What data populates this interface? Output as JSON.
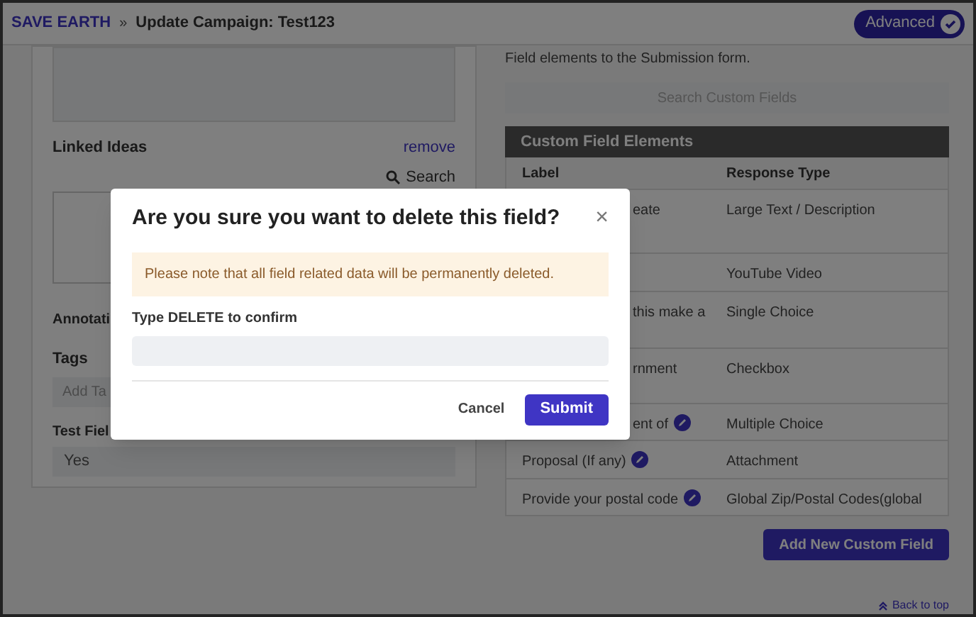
{
  "header": {
    "brand": "SAVE EARTH",
    "separator": "»",
    "title": "Update Campaign: Test123",
    "advanced": {
      "label": "Advanced",
      "on": true
    }
  },
  "left": {
    "linked_ideas": {
      "label": "Linked Ideas",
      "remove": "remove",
      "search": "Search"
    },
    "annotations_label": "Annotati",
    "tags_label": "Tags",
    "tags_placeholder": "Add Ta",
    "test_field_label": "Test Fiel",
    "test_field_value": "Yes"
  },
  "right": {
    "intro": "Field elements to the Submission form.",
    "search_placeholder": "Search Custom Fields",
    "table": {
      "title": "Custom Field Elements",
      "columns": [
        "Label",
        "Response Type"
      ],
      "rows": [
        {
          "label": "eate",
          "partial": true,
          "type": "Large Text / Description"
        },
        {
          "type": "YouTube Video"
        },
        {
          "label": "this make a",
          "partial": true,
          "type": "Single Choice"
        },
        {
          "label": "rnment",
          "partial": true,
          "type": "Checkbox"
        },
        {
          "label": "ent of",
          "partial": true,
          "editable": true,
          "type": "Multiple Choice"
        },
        {
          "label": "Proposal (If any)",
          "partial": false,
          "editable": true,
          "type": "Attachment"
        },
        {
          "label": "Provide your postal code",
          "partial": false,
          "editable": true,
          "type": "Global Zip/Postal Codes(global"
        }
      ]
    },
    "add_button": "Add New Custom Field",
    "back_to_top": "Back to top"
  },
  "modal": {
    "title": "Are you sure you want to delete this field?",
    "close": "×",
    "notice": "Please note that all field related data will be permanently deleted.",
    "confirm_label": "Type DELETE to confirm",
    "cancel": "Cancel",
    "submit": "Submit"
  }
}
